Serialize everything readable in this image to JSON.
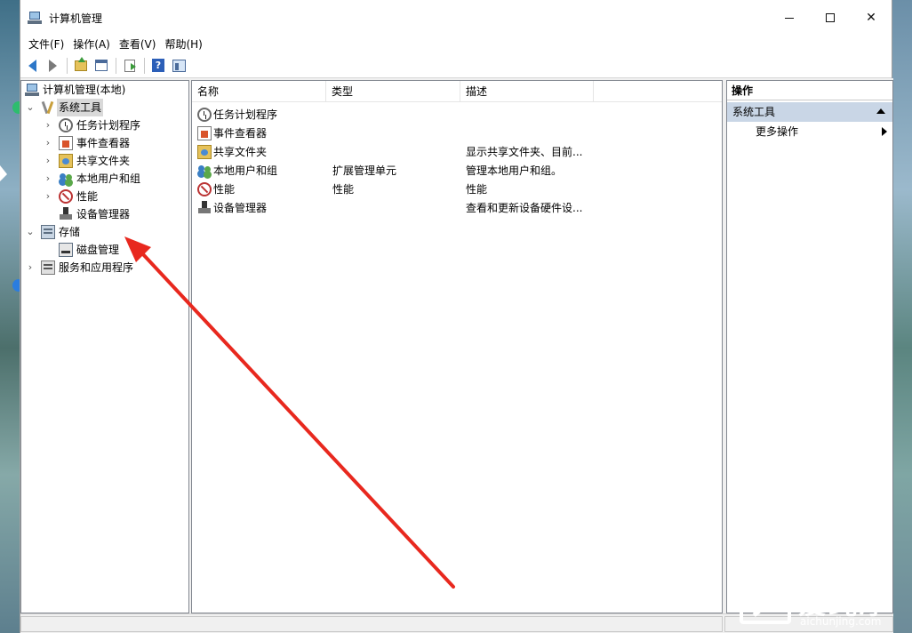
{
  "window": {
    "title": "计算机管理",
    "controls": {
      "minimize": "",
      "maximize": "",
      "close": "✕"
    }
  },
  "menu": [
    "文件(F)",
    "操作(A)",
    "查看(V)",
    "帮助(H)"
  ],
  "toolbar": {
    "icons": [
      "back-arrow-icon",
      "forward-arrow-icon",
      "up-folder-icon",
      "show-hide-console-tree-icon",
      "export-list-icon",
      "help-icon",
      "show-action-pane-icon"
    ]
  },
  "tree": {
    "root": "计算机管理(本地)",
    "system_tools": "系统工具",
    "system_tools_children": [
      "任务计划程序",
      "事件查看器",
      "共享文件夹",
      "本地用户和组",
      "性能",
      "设备管理器"
    ],
    "storage": "存储",
    "storage_children": [
      "磁盘管理"
    ],
    "services": "服务和应用程序"
  },
  "list": {
    "columns": [
      "名称",
      "类型",
      "描述"
    ],
    "rows": [
      {
        "name": "任务计划程序",
        "type": "",
        "desc": ""
      },
      {
        "name": "事件查看器",
        "type": "",
        "desc": ""
      },
      {
        "name": "共享文件夹",
        "type": "",
        "desc": "显示共享文件夹、目前..."
      },
      {
        "name": "本地用户和组",
        "type": "扩展管理单元",
        "desc": "管理本地用户和组。"
      },
      {
        "name": "性能",
        "type": "性能",
        "desc": "性能"
      },
      {
        "name": "设备管理器",
        "type": "",
        "desc": "查看和更新设备硬件设..."
      }
    ]
  },
  "actions": {
    "header": "操作",
    "group": "系统工具",
    "more": "更多操作"
  },
  "watermark": {
    "brand": "爱纯净",
    "url": "aichunjing.com"
  },
  "colors": {
    "annotation_arrow": "#e8281e",
    "selection": "#d9d9d9",
    "action_group": "#c9d6e6"
  }
}
